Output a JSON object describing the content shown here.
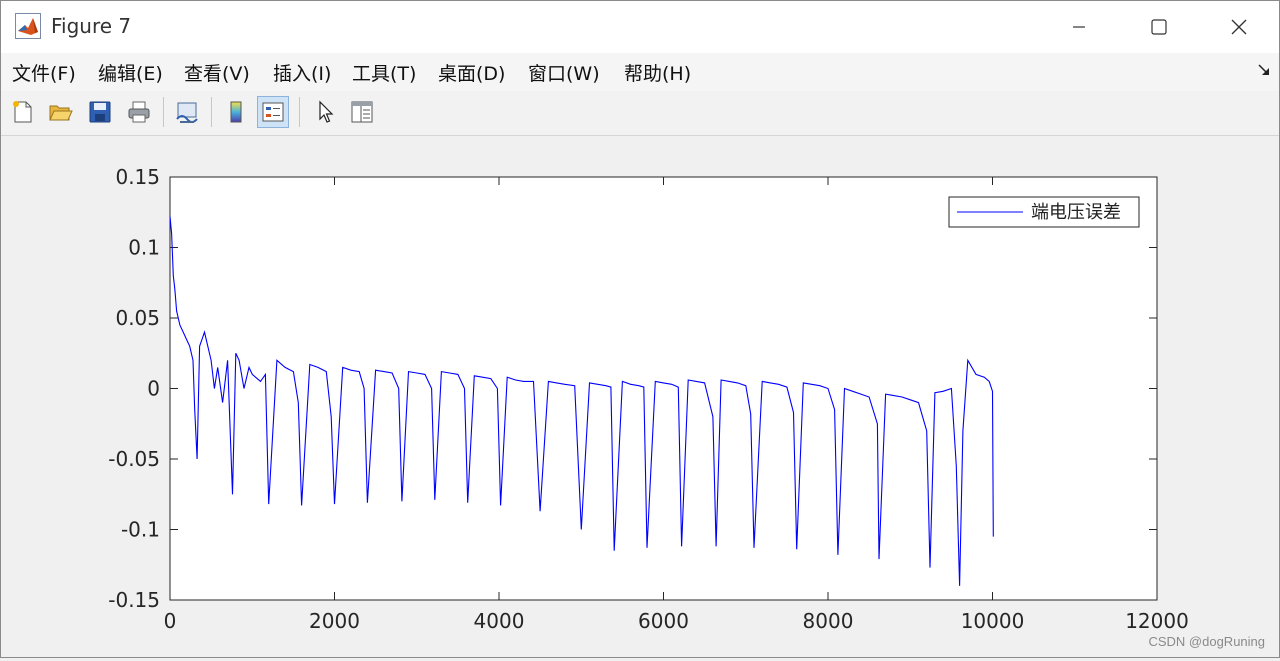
{
  "window": {
    "title": "Figure 7",
    "controls": [
      "minimize",
      "maximize",
      "close"
    ]
  },
  "menu": [
    "文件(F)",
    "编辑(E)",
    "查看(V)",
    "插入(I)",
    "工具(T)",
    "桌面(D)",
    "窗口(W)",
    "帮助(H)"
  ],
  "toolbar": [
    {
      "name": "new-figure",
      "icon": "new-file-icon"
    },
    {
      "name": "open-file",
      "icon": "folder-open-icon"
    },
    {
      "name": "save-figure",
      "icon": "save-icon"
    },
    {
      "name": "print-figure",
      "icon": "printer-icon"
    },
    {
      "name": "link-plot",
      "icon": "link-plot-icon"
    },
    {
      "name": "insert-colorbar",
      "icon": "colorbar-icon"
    },
    {
      "name": "insert-legend",
      "icon": "legend-icon",
      "active": true
    },
    {
      "name": "edit-plot",
      "icon": "pointer-icon"
    },
    {
      "name": "property-inspector",
      "icon": "property-editor-icon"
    }
  ],
  "chart_data": {
    "type": "line",
    "xlim": [
      0,
      12000
    ],
    "ylim": [
      -0.15,
      0.15
    ],
    "xticks": [
      0,
      2000,
      4000,
      6000,
      8000,
      10000,
      12000
    ],
    "xtick_labels": [
      "0",
      "2000",
      "4000",
      "6000",
      "8000",
      "10000",
      "12000"
    ],
    "yticks": [
      0.15,
      0.1,
      0.05,
      0,
      -0.05,
      -0.1,
      -0.15
    ],
    "ytick_labels": [
      "0.15",
      "0.1",
      "0.05",
      "0",
      "-0.05",
      "-0.1",
      "-0.15"
    ],
    "grid": false,
    "legend_position": "top-right",
    "series": [
      {
        "name": "端电压误差",
        "color": "#0000ff",
        "x": [
          0,
          20,
          40,
          60,
          80,
          120,
          160,
          200,
          240,
          280,
          300,
          330,
          360,
          390,
          420,
          460,
          500,
          540,
          580,
          640,
          700,
          760,
          800,
          840,
          900,
          960,
          1000,
          1100,
          1160,
          1200,
          1300,
          1400,
          1500,
          1560,
          1600,
          1700,
          1800,
          1900,
          1960,
          2000,
          2100,
          2200,
          2300,
          2360,
          2400,
          2500,
          2600,
          2700,
          2780,
          2820,
          2900,
          3000,
          3100,
          3180,
          3220,
          3300,
          3400,
          3500,
          3580,
          3620,
          3700,
          3800,
          3900,
          3980,
          4020,
          4100,
          4200,
          4300,
          4420,
          4500,
          4600,
          4700,
          4800,
          4920,
          5000,
          5100,
          5200,
          5300,
          5360,
          5400,
          5500,
          5600,
          5700,
          5760,
          5800,
          5900,
          6000,
          6100,
          6180,
          6220,
          6300,
          6400,
          6500,
          6600,
          6640,
          6700,
          6800,
          6900,
          7000,
          7060,
          7100,
          7200,
          7300,
          7400,
          7500,
          7580,
          7620,
          7700,
          7800,
          7900,
          8000,
          8080,
          8120,
          8200,
          8300,
          8400,
          8500,
          8600,
          8620,
          8700,
          8800,
          8900,
          9000,
          9100,
          9200,
          9240,
          9300,
          9400,
          9500,
          9560,
          9600,
          9640,
          9700,
          9800,
          9900,
          9960,
          10000,
          10010
        ],
        "y": [
          0.122,
          0.11,
          0.08,
          0.07,
          0.055,
          0.045,
          0.04,
          0.035,
          0.03,
          0.02,
          -0.015,
          -0.05,
          0.03,
          0.035,
          0.04,
          0.03,
          0.02,
          0.0,
          0.015,
          -0.01,
          0.02,
          -0.075,
          0.025,
          0.02,
          0.0,
          0.015,
          0.01,
          0.005,
          0.01,
          -0.082,
          0.02,
          0.015,
          0.012,
          -0.01,
          -0.083,
          0.017,
          0.015,
          0.012,
          -0.02,
          -0.082,
          0.015,
          0.013,
          0.012,
          0.0,
          -0.081,
          0.013,
          0.012,
          0.011,
          0.0,
          -0.08,
          0.012,
          0.011,
          0.01,
          0.0,
          -0.079,
          0.012,
          0.011,
          0.01,
          0.0,
          -0.081,
          0.009,
          0.008,
          0.007,
          0.0,
          -0.083,
          0.008,
          0.006,
          0.005,
          0.005,
          -0.087,
          0.005,
          0.004,
          0.003,
          0.002,
          -0.1,
          0.004,
          0.003,
          0.002,
          0.001,
          -0.115,
          0.005,
          0.003,
          0.002,
          0.001,
          -0.113,
          0.005,
          0.004,
          0.003,
          0.001,
          -0.112,
          0.006,
          0.005,
          0.004,
          -0.02,
          -0.112,
          0.006,
          0.005,
          0.004,
          0.002,
          -0.018,
          -0.113,
          0.005,
          0.004,
          0.003,
          0.001,
          -0.017,
          -0.114,
          0.004,
          0.003,
          0.002,
          0.0,
          -0.015,
          -0.118,
          0.0,
          -0.002,
          -0.004,
          -0.006,
          -0.025,
          -0.121,
          -0.004,
          -0.005,
          -0.006,
          -0.008,
          -0.01,
          -0.03,
          -0.127,
          -0.003,
          -0.002,
          0.0,
          -0.055,
          -0.14,
          -0.03,
          0.02,
          0.01,
          0.008,
          0.005,
          -0.002,
          -0.105
        ]
      }
    ]
  },
  "watermark": "CSDN @dogRuning"
}
